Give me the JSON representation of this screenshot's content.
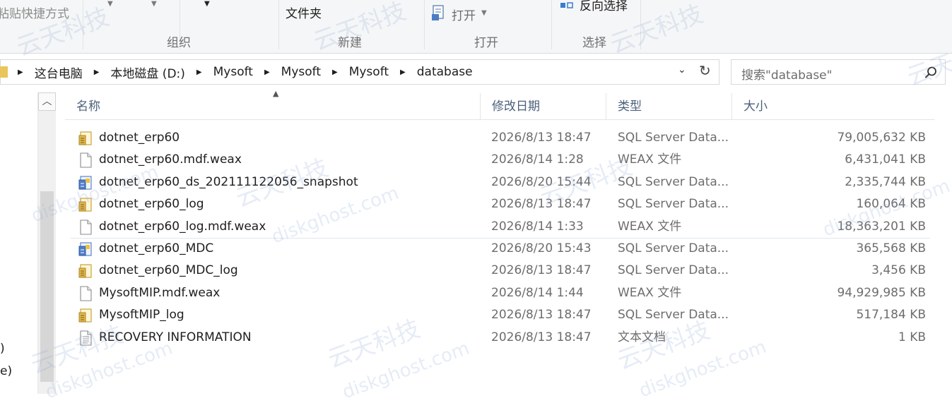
{
  "ribbon": {
    "paste_shortcut": "粘贴快捷方式",
    "new_folder": "文件夹",
    "open": "打开",
    "invert_selection": "反向选择",
    "groups": {
      "organize": "组织",
      "new": "新建",
      "open": "打开",
      "select": "选择"
    }
  },
  "address": {
    "crumbs": [
      "这台电脑",
      "本地磁盘 (D:)",
      "Mysoft",
      "Mysoft",
      "Mysoft",
      "database"
    ]
  },
  "search": {
    "placeholder": "搜索\"database\""
  },
  "nav": {
    "partial_1": ")",
    "partial_2": "e)"
  },
  "columns": {
    "name": "名称",
    "modified": "修改日期",
    "type": "类型",
    "size": "大小"
  },
  "files": [
    {
      "name": "dotnet_erp60",
      "modified": "2026/8/13 18:47",
      "type": "SQL Server Data...",
      "size": "79,005,632 KB",
      "icon": "sql-data-icon"
    },
    {
      "name": "dotnet_erp60.mdf.weax",
      "modified": "2026/8/14 1:28",
      "type": "WEAX 文件",
      "size": "6,431,041 KB",
      "icon": "blank-file-icon"
    },
    {
      "name": "dotnet_erp60_ds_202111122056_snapshot",
      "modified": "2026/8/20 15:44",
      "type": "SQL Server Data...",
      "size": "2,335,744 KB",
      "icon": "sql-snapshot-icon"
    },
    {
      "name": "dotnet_erp60_log",
      "modified": "2026/8/13 18:47",
      "type": "SQL Server Data...",
      "size": "160,064 KB",
      "icon": "sql-data-icon"
    },
    {
      "name": "dotnet_erp60_log.mdf.weax",
      "modified": "2026/8/14 1:33",
      "type": "WEAX 文件",
      "size": "18,363,201 KB",
      "icon": "blank-file-icon"
    },
    {
      "name": "dotnet_erp60_MDC",
      "modified": "2026/8/20 15:43",
      "type": "SQL Server Data...",
      "size": "365,568 KB",
      "icon": "sql-snapshot-icon"
    },
    {
      "name": "dotnet_erp60_MDC_log",
      "modified": "2026/8/13 18:47",
      "type": "SQL Server Data...",
      "size": "3,456 KB",
      "icon": "sql-data-icon"
    },
    {
      "name": "MysoftMIP.mdf.weax",
      "modified": "2026/8/14 1:44",
      "type": "WEAX 文件",
      "size": "94,929,985 KB",
      "icon": "blank-file-icon"
    },
    {
      "name": "MysoftMIP_log",
      "modified": "2026/8/13 18:47",
      "type": "SQL Server Data...",
      "size": "517,184 KB",
      "icon": "sql-data-icon"
    },
    {
      "name": "RECOVERY INFORMATION",
      "modified": "2026/8/13 18:47",
      "type": "文本文档",
      "size": "1 KB",
      "icon": "text-document-icon"
    }
  ],
  "watermark": {
    "cn": "云天科技",
    "en": "diskghost.com"
  }
}
